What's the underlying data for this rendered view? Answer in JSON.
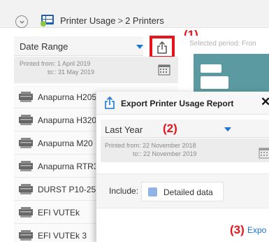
{
  "breadcrumb": {
    "app": "Printer Usage",
    "separator": ">",
    "current": "2 Printers"
  },
  "left_panel": {
    "date_select": {
      "value": "Date Range"
    },
    "printed_from": "Printed from: 1 April 2019",
    "printed_to": "to:: 31 May 2019",
    "printers": [
      "Anapurna H205",
      "Anapurna H320",
      "Anapurna M20",
      "Anapurna RTR3",
      "DURST P10-25",
      "EFI VUTEk",
      "EFI VUTEk 3"
    ]
  },
  "right_panel": {
    "selected_period_label": "Selected period: Fron"
  },
  "dialog": {
    "title": "Export Printer Usage Report",
    "close_symbol": "✕",
    "period_select": {
      "value": "Last Year"
    },
    "printed_from": "Printed from: 22 November 2018",
    "printed_to": "to:: 22 November 2019",
    "include_label": "Include:",
    "detailed_data_label": "Detailed data",
    "export_label": "Expo"
  },
  "annotations": {
    "step1": "(1)",
    "step2": "(2)",
    "step3": "(3)"
  },
  "colors": {
    "accent": "#1976d2",
    "highlight": "#e8141b",
    "preview_card": "#5b9aa0",
    "checkbox": "#90b4e6"
  }
}
